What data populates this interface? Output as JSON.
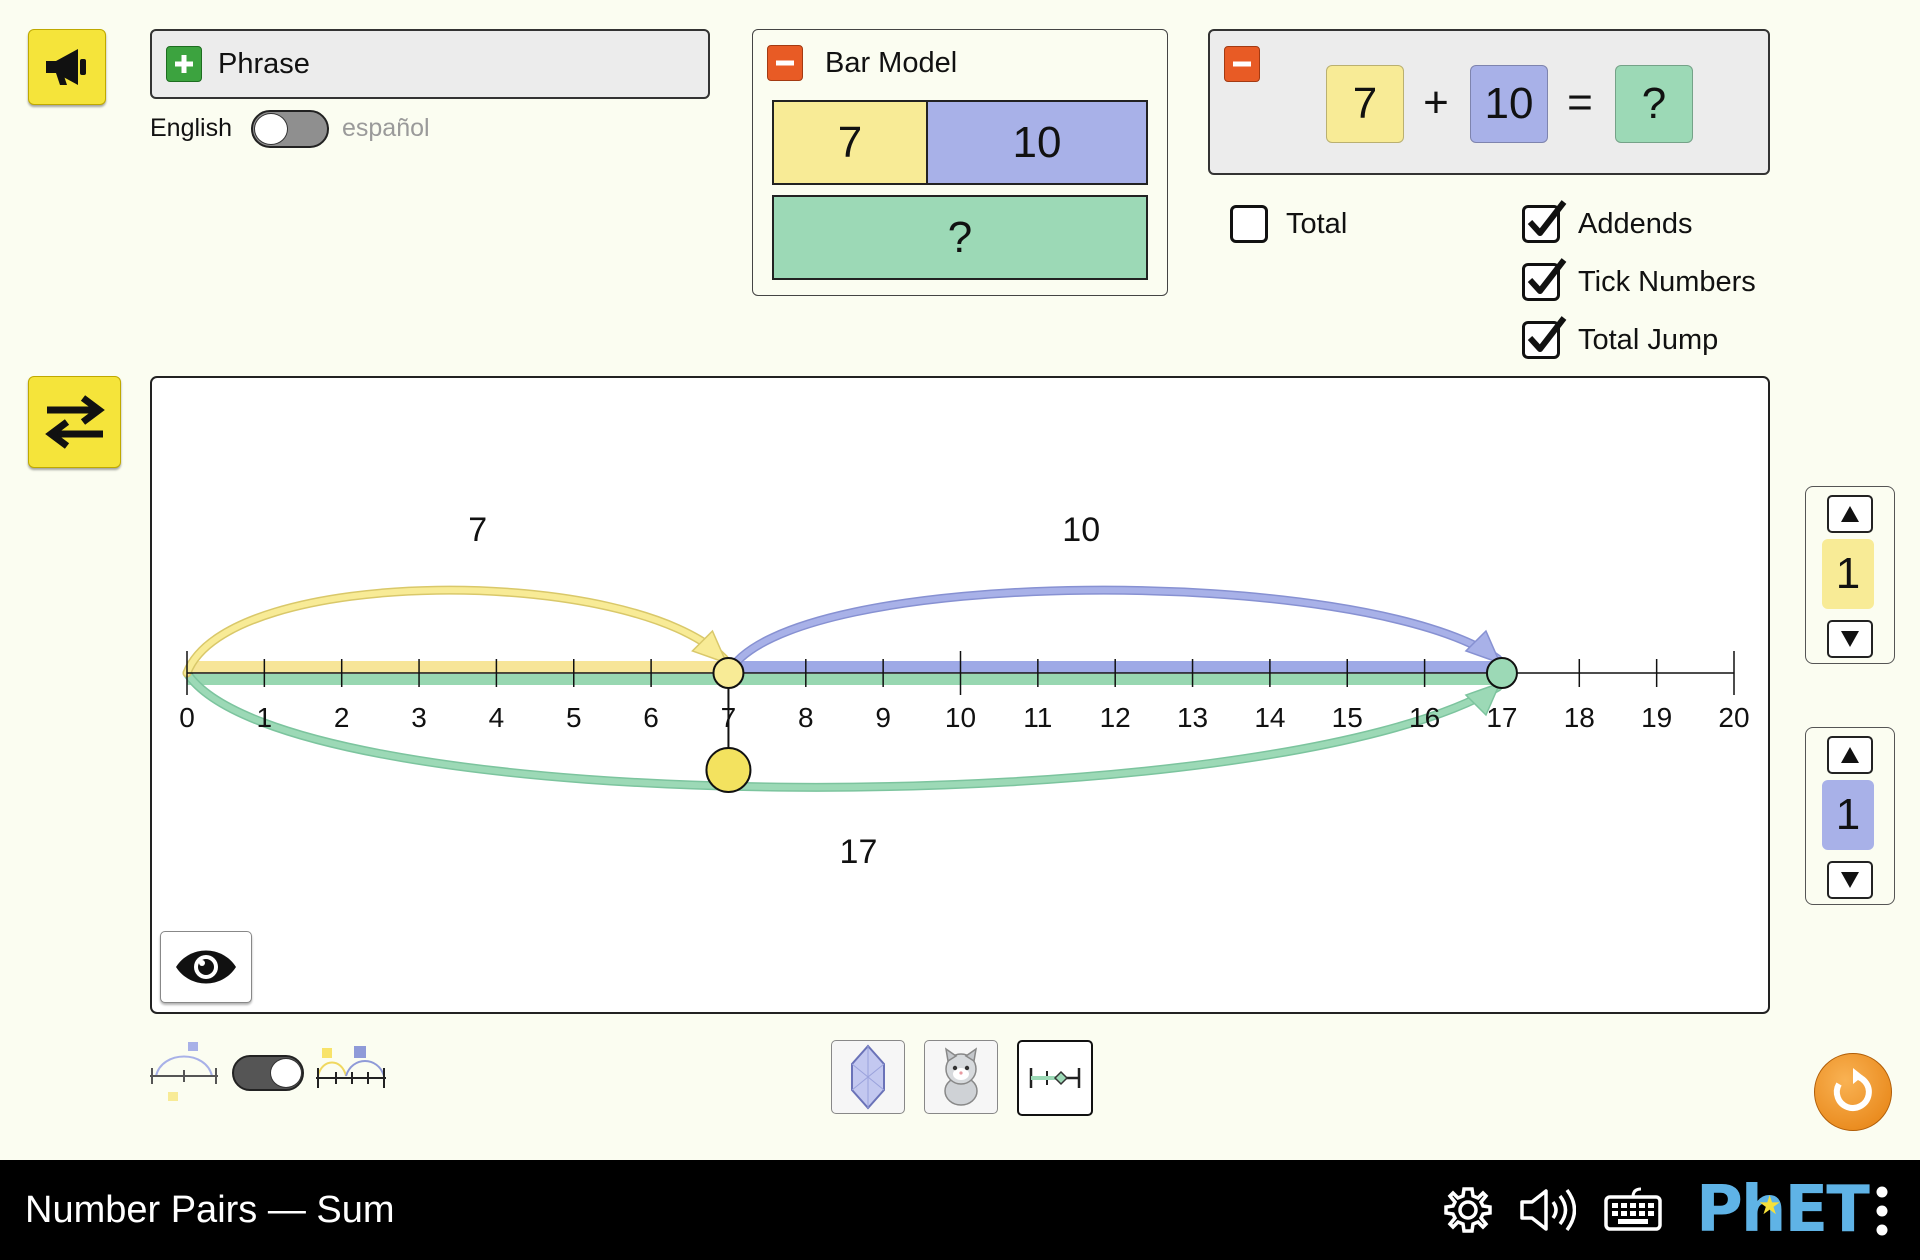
{
  "phrase_panel": {
    "title": "Phrase",
    "lang_left": "English",
    "lang_right": "español"
  },
  "bar_model": {
    "title": "Bar Model",
    "left_value": "7",
    "right_value": "10",
    "total_value": "?"
  },
  "equation": {
    "addend1": "7",
    "plus": "+",
    "addend2": "10",
    "equals": "=",
    "total": "?"
  },
  "checkboxes": [
    {
      "label": "Total",
      "checked": false
    },
    {
      "label": "Addends",
      "checked": true
    },
    {
      "label": "Tick Numbers",
      "checked": true
    },
    {
      "label": "Total Jump",
      "checked": true
    }
  ],
  "number_line": {
    "ticks": [
      "0",
      "1",
      "2",
      "3",
      "4",
      "5",
      "6",
      "7",
      "8",
      "9",
      "10",
      "11",
      "12",
      "13",
      "14",
      "15",
      "16",
      "17",
      "18",
      "19",
      "20"
    ],
    "min": 0,
    "max": 20,
    "addend1": 7,
    "addend2": 10,
    "total": 17,
    "jump_labels": {
      "addend1": "7",
      "addend2": "10",
      "total": "17"
    }
  },
  "spinners": [
    {
      "value": "1",
      "color": "#f8eb96"
    },
    {
      "value": "1",
      "color": "#a8b1e8"
    }
  ],
  "colors": {
    "yellow": "#f8eb96",
    "blue": "#a8b1e8",
    "green": "#9cd9b6",
    "yellow_bar": "#f7e598",
    "blue_bar": "#9ea9e6",
    "green_bar": "#98d7b1"
  },
  "footer": {
    "title": "Number Pairs — Sum",
    "brand": "PhET"
  },
  "icons": [
    "speaker-button-icon",
    "swap-icon",
    "eye-icon",
    "crystal-icon",
    "kitten-icon",
    "number-line-icon",
    "reset-icon",
    "settings-icon",
    "audio-icon",
    "keyboard-icon",
    "menu-icon"
  ]
}
